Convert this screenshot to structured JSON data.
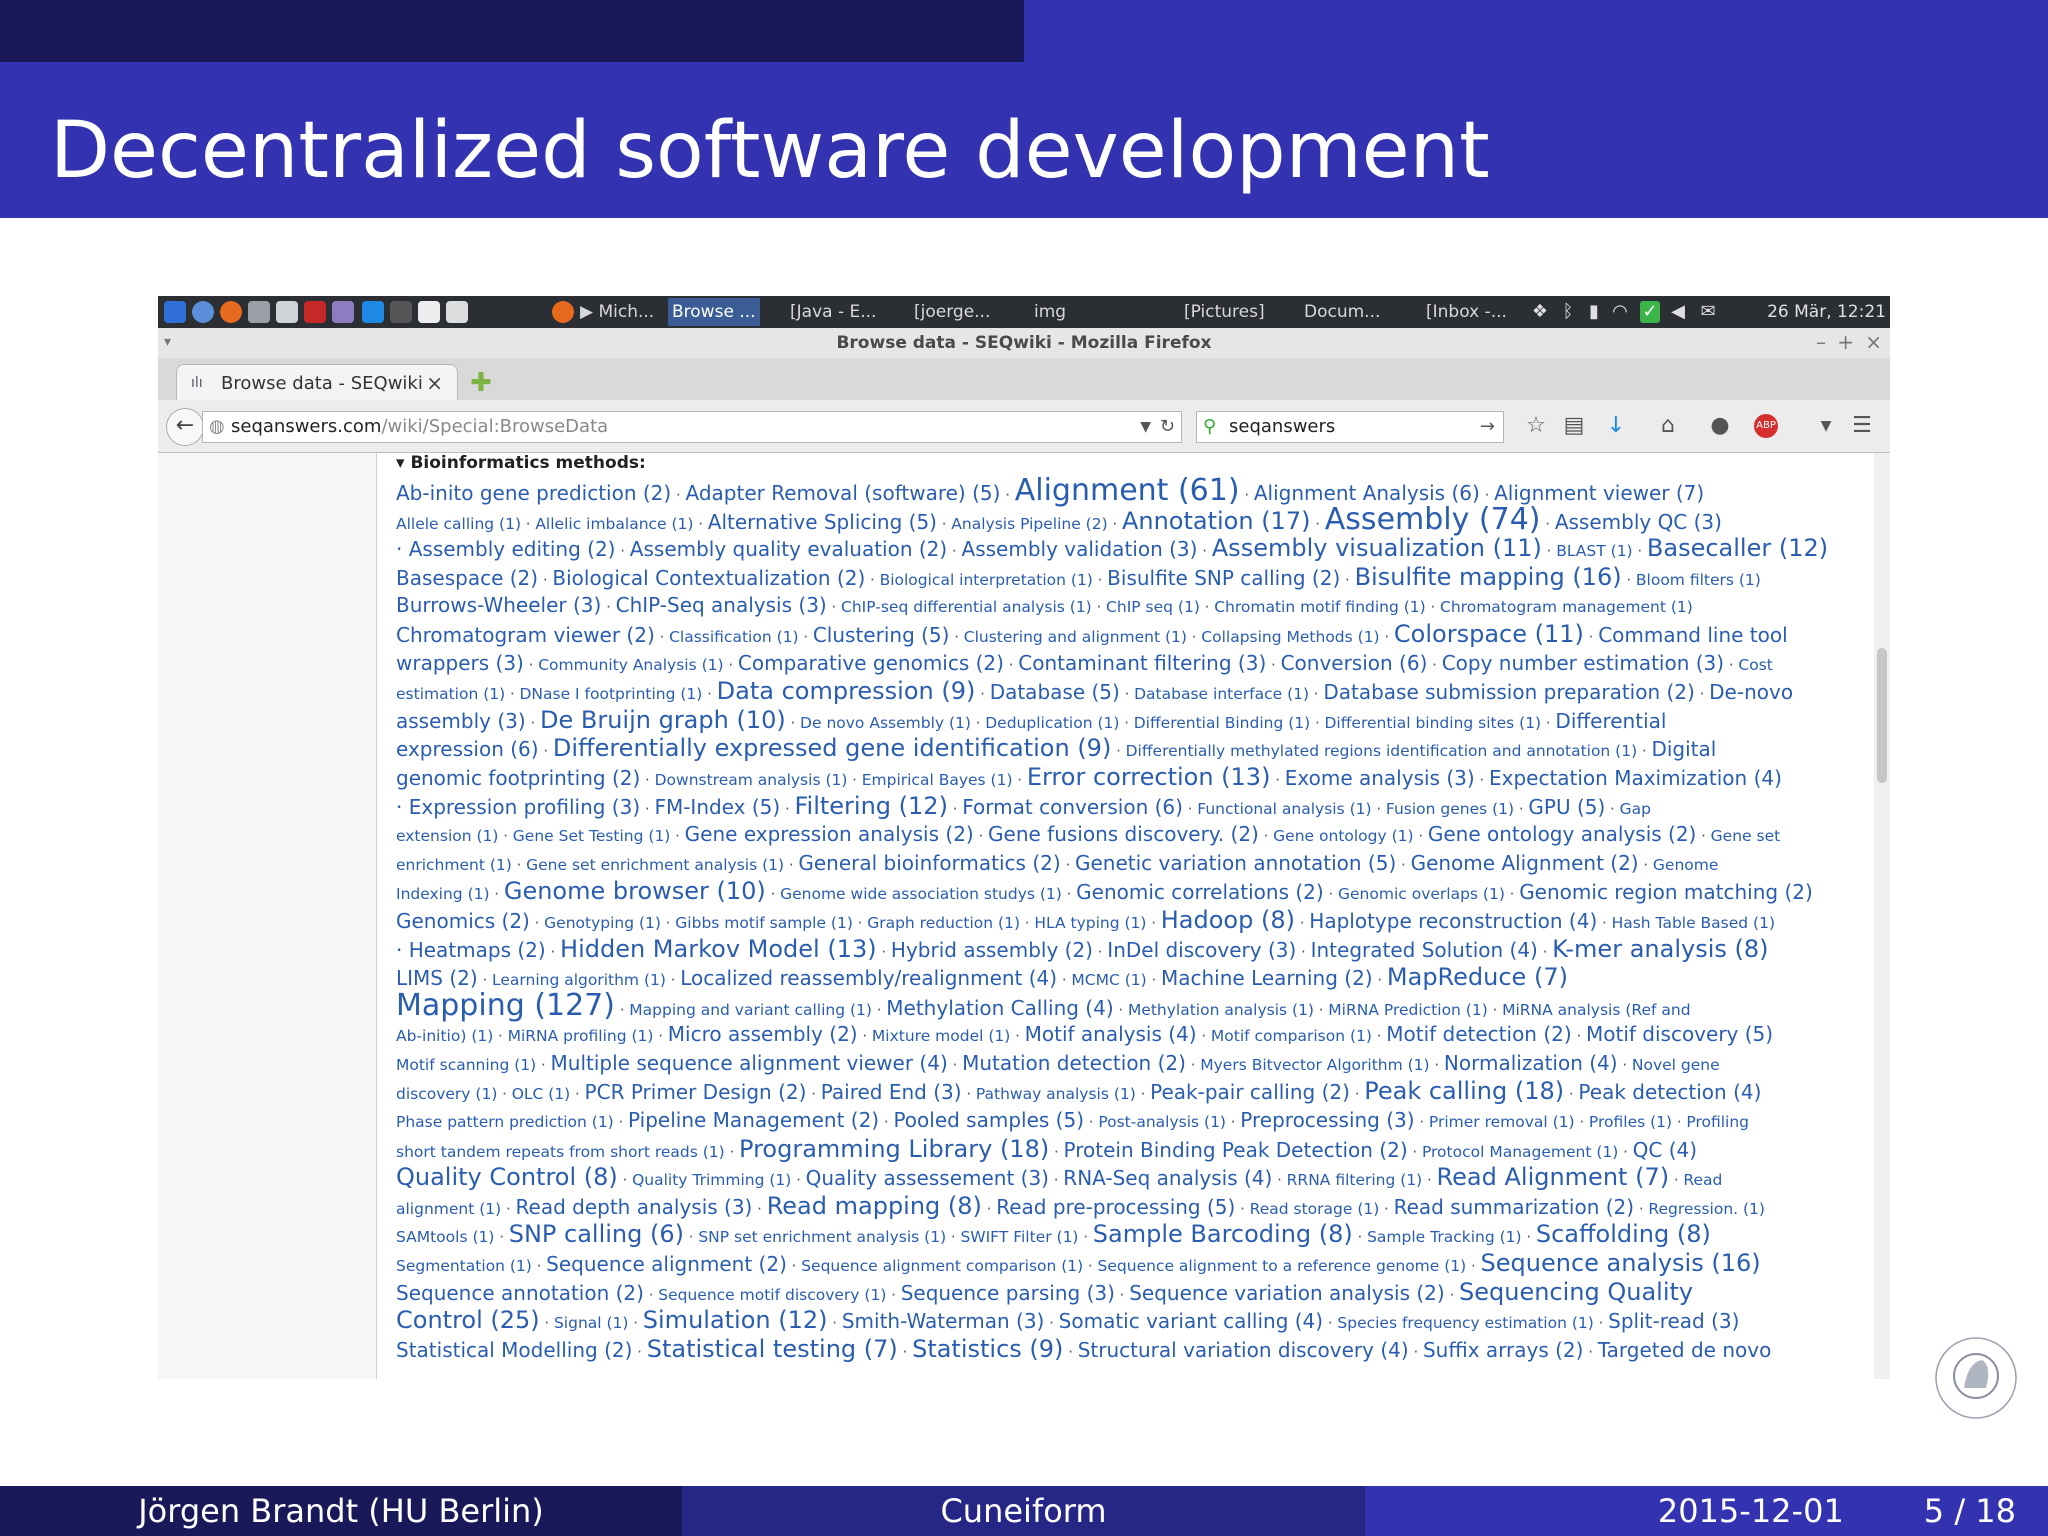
{
  "slide": {
    "title": "Decentralized software development",
    "footer": {
      "author": "Jörgen Brandt  (HU Berlin)",
      "talk": "Cuneiform",
      "date": "2015-12-01",
      "page": "5 / 18"
    }
  },
  "screenshot": {
    "panel": {
      "tasks": [
        "▶ Mich...",
        "Browse ...",
        "[Java - E...",
        "[joerge...",
        "img",
        "[Pictures]",
        "Docum...",
        "[Inbox -..."
      ],
      "clock": "26 Mär, 12:21"
    },
    "window_title": "Browse data - SEQwiki - Mozilla Firefox",
    "tab": {
      "label": "Browse data - SEQwiki",
      "close": "×",
      "new_tab": "✚"
    },
    "url": {
      "host": "seqanswers.com",
      "path": "/wiki/Special:BrowseData"
    },
    "search": {
      "value": "seqanswers"
    },
    "section_heading": "▾ Bioinformatics methods:",
    "tag_lines": [
      [
        [
          "Ab-inito gene prediction (2)",
          2
        ],
        [
          "Adapter Removal (software) (5)",
          2
        ],
        [
          "Alignment (61)",
          4
        ],
        [
          "Alignment Analysis (6)",
          2
        ],
        [
          "Alignment viewer (7)",
          2
        ]
      ],
      [
        [
          "Allele calling (1)",
          1
        ],
        [
          "Allelic imbalance (1)",
          1
        ],
        [
          "Alternative Splicing (5)",
          2
        ],
        [
          "Analysis Pipeline (2)",
          1
        ],
        [
          "Annotation (17)",
          3
        ],
        [
          "Assembly (74)",
          4
        ],
        [
          "Assembly QC (3)",
          2
        ]
      ],
      [
        [
          "· Assembly editing (2)",
          2
        ],
        [
          "Assembly quality evaluation (2)",
          2
        ],
        [
          "Assembly validation (3)",
          2
        ],
        [
          "Assembly visualization (11)",
          3
        ],
        [
          "BLAST (1)",
          1
        ],
        [
          "Basecaller (12)",
          3
        ]
      ],
      [
        [
          "Basespace (2)",
          2
        ],
        [
          "Biological Contextualization (2)",
          2
        ],
        [
          "Biological interpretation (1)",
          1
        ],
        [
          "Bisulfite SNP calling (2)",
          2
        ],
        [
          "Bisulfite mapping (16)",
          3
        ],
        [
          "Bloom filters (1)",
          1
        ]
      ],
      [
        [
          "Burrows-Wheeler (3)",
          2
        ],
        [
          "ChIP-Seq analysis (3)",
          2
        ],
        [
          "ChIP-seq differential analysis (1)",
          1
        ],
        [
          "ChIP seq (1)",
          1
        ],
        [
          "Chromatin motif finding (1)",
          1
        ],
        [
          "Chromatogram management (1)",
          1
        ]
      ],
      [
        [
          "Chromatogram viewer (2)",
          2
        ],
        [
          "Classification (1)",
          1
        ],
        [
          "Clustering (5)",
          2
        ],
        [
          "Clustering and alignment (1)",
          1
        ],
        [
          "Collapsing Methods (1)",
          1
        ],
        [
          "Colorspace (11)",
          3
        ],
        [
          "Command line tool",
          2
        ]
      ],
      [
        [
          "wrappers (3)",
          2
        ],
        [
          "Community Analysis (1)",
          1
        ],
        [
          "Comparative genomics (2)",
          2
        ],
        [
          "Contaminant filtering (3)",
          2
        ],
        [
          "Conversion (6)",
          2
        ],
        [
          "Copy number estimation (3)",
          2
        ],
        [
          "Cost",
          1
        ]
      ],
      [
        [
          "estimation (1)",
          1
        ],
        [
          "DNase I footprinting (1)",
          1
        ],
        [
          "Data compression (9)",
          3
        ],
        [
          "Database (5)",
          2
        ],
        [
          "Database interface (1)",
          1
        ],
        [
          "Database submission preparation (2)",
          2
        ],
        [
          "De-novo",
          2
        ]
      ],
      [
        [
          "assembly (3)",
          2
        ],
        [
          "De Bruijn graph (10)",
          3
        ],
        [
          "De novo Assembly (1)",
          1
        ],
        [
          "Deduplication (1)",
          1
        ],
        [
          "Differential Binding (1)",
          1
        ],
        [
          "Differential binding sites (1)",
          1
        ],
        [
          "Differential",
          2
        ]
      ],
      [
        [
          "expression (6)",
          2
        ],
        [
          "Differentially expressed gene identification (9)",
          3
        ],
        [
          "Differentially methylated regions identification and annotation (1)",
          1
        ],
        [
          "Digital",
          2
        ]
      ],
      [
        [
          "genomic footprinting (2)",
          2
        ],
        [
          "Downstream analysis (1)",
          1
        ],
        [
          "Empirical Bayes (1)",
          1
        ],
        [
          "Error correction (13)",
          3
        ],
        [
          "Exome analysis (3)",
          2
        ],
        [
          "Expectation Maximization (4)",
          2
        ]
      ],
      [
        [
          "· Expression profiling (3)",
          2
        ],
        [
          "FM-Index (5)",
          2
        ],
        [
          "Filtering (12)",
          3
        ],
        [
          "Format conversion (6)",
          2
        ],
        [
          "Functional analysis (1)",
          1
        ],
        [
          "Fusion genes (1)",
          1
        ],
        [
          "GPU (5)",
          2
        ],
        [
          "Gap",
          1
        ]
      ],
      [
        [
          "extension (1)",
          1
        ],
        [
          "Gene Set Testing (1)",
          1
        ],
        [
          "Gene expression analysis (2)",
          2
        ],
        [
          "Gene fusions discovery. (2)",
          2
        ],
        [
          "Gene ontology (1)",
          1
        ],
        [
          "Gene ontology analysis (2)",
          2
        ],
        [
          "Gene set",
          1
        ]
      ],
      [
        [
          "enrichment (1)",
          1
        ],
        [
          "Gene set enrichment analysis (1)",
          1
        ],
        [
          "General bioinformatics (2)",
          2
        ],
        [
          "Genetic variation annotation (5)",
          2
        ],
        [
          "Genome Alignment (2)",
          2
        ],
        [
          "Genome",
          1
        ]
      ],
      [
        [
          "Indexing (1)",
          1
        ],
        [
          "Genome browser (10)",
          3
        ],
        [
          "Genome wide association studys (1)",
          1
        ],
        [
          "Genomic correlations (2)",
          2
        ],
        [
          "Genomic overlaps (1)",
          1
        ],
        [
          "Genomic region matching (2)",
          2
        ]
      ],
      [
        [
          "Genomics (2)",
          2
        ],
        [
          "Genotyping (1)",
          1
        ],
        [
          "Gibbs motif sample (1)",
          1
        ],
        [
          "Graph reduction (1)",
          1
        ],
        [
          "HLA typing (1)",
          1
        ],
        [
          "Hadoop (8)",
          3
        ],
        [
          "Haplotype reconstruction (4)",
          2
        ],
        [
          "Hash Table Based (1)",
          1
        ]
      ],
      [
        [
          "· Heatmaps (2)",
          2
        ],
        [
          "Hidden Markov Model (13)",
          3
        ],
        [
          "Hybrid assembly (2)",
          2
        ],
        [
          "InDel discovery (3)",
          2
        ],
        [
          "Integrated Solution (4)",
          2
        ],
        [
          "K-mer analysis (8)",
          3
        ]
      ],
      [
        [
          "LIMS (2)",
          2
        ],
        [
          "Learning algorithm (1)",
          1
        ],
        [
          "Localized reassembly/realignment (4)",
          2
        ],
        [
          "MCMC (1)",
          1
        ],
        [
          "Machine Learning (2)",
          2
        ],
        [
          "MapReduce (7)",
          3
        ]
      ],
      [
        [
          "Mapping (127)",
          4
        ],
        [
          "Mapping and variant calling (1)",
          1
        ],
        [
          "Methylation Calling (4)",
          2
        ],
        [
          "Methylation analysis (1)",
          1
        ],
        [
          "MiRNA Prediction (1)",
          1
        ],
        [
          "MiRNA analysis (Ref and",
          1
        ]
      ],
      [
        [
          "Ab-initio) (1)",
          1
        ],
        [
          "MiRNA profiling (1)",
          1
        ],
        [
          "Micro assembly (2)",
          2
        ],
        [
          "Mixture model (1)",
          1
        ],
        [
          "Motif analysis (4)",
          2
        ],
        [
          "Motif comparison (1)",
          1
        ],
        [
          "Motif detection (2)",
          2
        ],
        [
          "Motif discovery (5)",
          2
        ]
      ],
      [
        [
          "Motif scanning (1)",
          1
        ],
        [
          "Multiple sequence alignment viewer (4)",
          2
        ],
        [
          "Mutation detection (2)",
          2
        ],
        [
          "Myers Bitvector Algorithm (1)",
          1
        ],
        [
          "Normalization (4)",
          2
        ],
        [
          "Novel gene",
          1
        ]
      ],
      [
        [
          "discovery (1)",
          1
        ],
        [
          "OLC (1)",
          1
        ],
        [
          "PCR Primer Design (2)",
          2
        ],
        [
          "Paired End (3)",
          2
        ],
        [
          "Pathway analysis (1)",
          1
        ],
        [
          "Peak-pair calling (2)",
          2
        ],
        [
          "Peak calling (18)",
          3
        ],
        [
          "Peak detection (4)",
          2
        ]
      ],
      [
        [
          "Phase pattern prediction (1)",
          1
        ],
        [
          "Pipeline Management (2)",
          2
        ],
        [
          "Pooled samples (5)",
          2
        ],
        [
          "Post-analysis (1)",
          1
        ],
        [
          "Preprocessing (3)",
          2
        ],
        [
          "Primer removal (1)",
          1
        ],
        [
          "Profiles (1)",
          1
        ],
        [
          "Profiling",
          1
        ]
      ],
      [
        [
          "short tandem repeats from short reads (1)",
          1
        ],
        [
          "Programming Library (18)",
          3
        ],
        [
          "Protein Binding Peak Detection (2)",
          2
        ],
        [
          "Protocol Management (1)",
          1
        ],
        [
          "QC (4)",
          2
        ]
      ],
      [
        [
          "Quality Control (8)",
          3
        ],
        [
          "Quality Trimming (1)",
          1
        ],
        [
          "Quality assessement (3)",
          2
        ],
        [
          "RNA-Seq analysis (4)",
          2
        ],
        [
          "RRNA filtering (1)",
          1
        ],
        [
          "Read Alignment (7)",
          3
        ],
        [
          "Read",
          1
        ]
      ],
      [
        [
          "alignment (1)",
          1
        ],
        [
          "Read depth analysis (3)",
          2
        ],
        [
          "Read mapping (8)",
          3
        ],
        [
          "Read pre-processing (5)",
          2
        ],
        [
          "Read storage (1)",
          1
        ],
        [
          "Read summarization (2)",
          2
        ],
        [
          "Regression. (1)",
          1
        ]
      ],
      [
        [
          "SAMtools (1)",
          1
        ],
        [
          "SNP calling (6)",
          3
        ],
        [
          "SNP set enrichment analysis (1)",
          1
        ],
        [
          "SWIFT Filter (1)",
          1
        ],
        [
          "Sample Barcoding (8)",
          3
        ],
        [
          "Sample Tracking (1)",
          1
        ],
        [
          "Scaffolding (8)",
          3
        ]
      ],
      [
        [
          "Segmentation (1)",
          1
        ],
        [
          "Sequence alignment (2)",
          2
        ],
        [
          "Sequence alignment comparison (1)",
          1
        ],
        [
          "Sequence alignment to a reference genome (1)",
          1
        ],
        [
          "Sequence analysis (16)",
          3
        ]
      ],
      [
        [
          "Sequence annotation (2)",
          2
        ],
        [
          "Sequence motif discovery (1)",
          1
        ],
        [
          "Sequence parsing (3)",
          2
        ],
        [
          "Sequence variation analysis (2)",
          2
        ],
        [
          "Sequencing Quality",
          3
        ]
      ],
      [
        [
          "Control (25)",
          3
        ],
        [
          "Signal (1)",
          1
        ],
        [
          "Simulation (12)",
          3
        ],
        [
          "Smith-Waterman (3)",
          2
        ],
        [
          "Somatic variant calling (4)",
          2
        ],
        [
          "Species frequency estimation (1)",
          1
        ],
        [
          "Split-read (3)",
          2
        ]
      ],
      [
        [
          "Statistical Modelling (2)",
          2
        ],
        [
          "Statistical testing (7)",
          3
        ],
        [
          "Statistics (9)",
          3
        ],
        [
          "Structural variation discovery (4)",
          2
        ],
        [
          "Suffix arrays (2)",
          2
        ],
        [
          "Targeted de novo",
          2
        ]
      ]
    ]
  },
  "colors": {
    "tag_link": "#2a5db0",
    "slide_blue": "#3333b2",
    "slide_dark": "#191959"
  }
}
